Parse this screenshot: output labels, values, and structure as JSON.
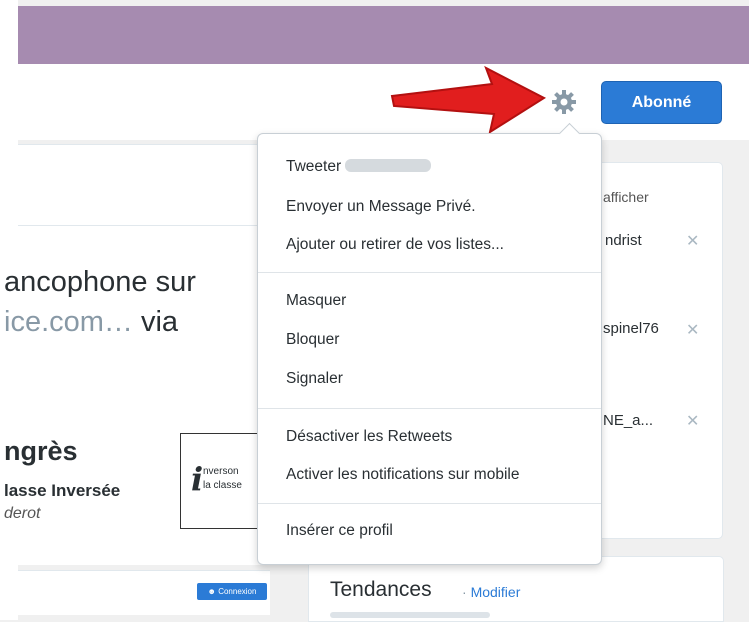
{
  "header": {
    "follow_button": "Abonné",
    "accent_color": "#2b7bd6",
    "banner_color": "#a68bb0"
  },
  "tweet": {
    "line1": "ancophone sur",
    "line2_link": "ice.com…",
    "line2_via": "via"
  },
  "card": {
    "title": "ngrès",
    "subtitle": "lasse Inversée",
    "author": "derot",
    "logo_line1": "nverson",
    "logo_line2": "la classe"
  },
  "login_button": "Connexion",
  "suggestions": {
    "header_fragment": "afficher",
    "items": [
      {
        "name": "ndrist"
      },
      {
        "name": "spinel76"
      },
      {
        "name": "NE_a..."
      }
    ]
  },
  "trends": {
    "title": "Tendances",
    "separator": "·",
    "edit": "Modifier"
  },
  "menu": {
    "items": {
      "tweet": "Tweeter",
      "dm": "Envoyer un Message Privé.",
      "lists": "Ajouter ou retirer de vos listes...",
      "mute": "Masquer",
      "block": "Bloquer",
      "report": "Signaler",
      "retweets_off": "Désactiver les Retweets",
      "mobile_notifications": "Activer les notifications sur mobile",
      "embed": "Insérer ce profil"
    }
  },
  "icons": {
    "settings": "gear-icon",
    "pointer": "red-arrow-icon",
    "dismiss": "close-icon"
  }
}
